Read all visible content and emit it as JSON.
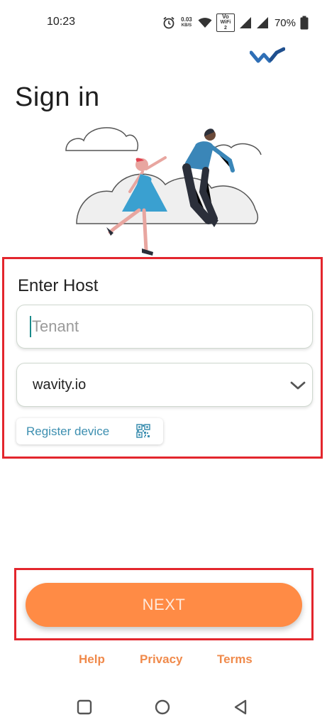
{
  "status_bar": {
    "time": "10:23",
    "net_speed_value": "0.03",
    "net_speed_unit": "KB/S",
    "wifi_label_top": "Vo",
    "wifi_label_bottom": "WiFi 2",
    "battery": "70%"
  },
  "page": {
    "title": "Sign in"
  },
  "host": {
    "heading": "Enter Host",
    "tenant_placeholder": "Tenant",
    "tenant_value": "",
    "domain_value": "wavity.io",
    "register_label": "Register device"
  },
  "actions": {
    "next_label": "NEXT"
  },
  "footer": {
    "help": "Help",
    "privacy": "Privacy",
    "terms": "Terms"
  },
  "colors": {
    "accent_orange": "#ff8b45",
    "link_orange": "#f08a4b",
    "highlight_red": "#e3262d",
    "brand_blue": "#2f6fb6",
    "link_blue": "#3d8fb0"
  },
  "icons": {
    "alarm": "alarm-icon",
    "wifi": "wifi-icon",
    "signal": "signal-icon",
    "battery": "battery-icon",
    "chevron": "chevron-down-icon",
    "qr": "qr-code-icon",
    "nav_recent": "recent-apps-icon",
    "nav_home": "home-icon",
    "nav_back": "back-icon"
  }
}
